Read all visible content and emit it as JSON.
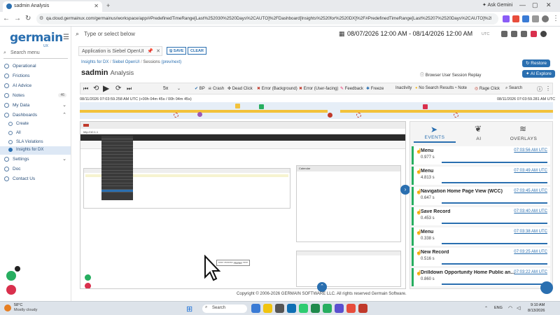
{
  "browser": {
    "tab_title": "sadmin Analysis",
    "ask_gemini": "Ask Gemini",
    "url": "qa.cloud.germainux.com/germainus/workspace/app/#PredefinedTimeRange[Last%252030%2520Days%2CAUTO]%2FDashboard[Insights%2520for%2520DX]%2F#PredefinedTimeRange[Last%25207%2520Days%2CAUTO]%2FFilter[Applicati..."
  },
  "sidebar": {
    "logo": "germain",
    "logo_sub": "UX",
    "search_placeholder": "Search menu",
    "items": [
      {
        "label": "Operational"
      },
      {
        "label": "Frictions"
      },
      {
        "label": "AI Advice"
      },
      {
        "label": "Notes",
        "badge": "46"
      },
      {
        "label": "My Data"
      },
      {
        "label": "Dashboards"
      },
      {
        "label": "Create"
      },
      {
        "label": "All"
      },
      {
        "label": "SLA Violations"
      },
      {
        "label": "Insights for DX"
      },
      {
        "label": "Settings"
      },
      {
        "label": "Doc"
      },
      {
        "label": "Contact Us"
      }
    ]
  },
  "topbar": {
    "search_placeholder": "Type or select below",
    "date_range": "08/07/2026 12:00 AM - 08/14/2026 12:00 AM",
    "timezone": "UTC"
  },
  "filter": {
    "chip": "Application  is  Siebel OpenUI",
    "save": "SAVE",
    "clear": "CLEAR"
  },
  "breadcrumb": {
    "insights": "Insights for DX",
    "app": "Siebel OpenUI",
    "sessions": "Sessions",
    "prevnext": "(prev/next)"
  },
  "page": {
    "title": "sadmin",
    "title_sub": "Analysis",
    "restore": "Restore",
    "ai_explore": "AI Explore",
    "replay_label": "Browser User Session Replay"
  },
  "toolbar": {
    "speed": "5x",
    "filters": [
      "BP",
      "Crash",
      "Dead Click",
      "Error (Background)",
      "Error (User-facing)",
      "Feedback",
      "Freeze",
      "Inactivity",
      "No Search Results",
      "Note",
      "Rage Click",
      "Search"
    ]
  },
  "timeline": {
    "start": "08/11/2026 07:03:59.258 AM UTC (+00h 04m 45s / 00h 04m 45s)",
    "end": "08/11/2026 07:03:59.281 AM UTC"
  },
  "replay": {
    "url": "http://10.1.1",
    "tooltip": "**** ******* Home ****",
    "calendar_title": "Calendar"
  },
  "rpanel": {
    "tabs": [
      "EVENTS",
      "AI",
      "OVERLAYS"
    ],
    "events": [
      {
        "name": "Menu",
        "time": "07:03:56 AM UTC",
        "duration": "0.977 s"
      },
      {
        "name": "Menu",
        "time": "07:03:49 AM UTC",
        "duration": "4.813 s"
      },
      {
        "name": "Navigation Home Page View (WCC)",
        "time": "07:03:45 AM UTC",
        "duration": "0.647 s"
      },
      {
        "name": "Save Record",
        "time": "07:03:40 AM UTC",
        "duration": "0.453 s"
      },
      {
        "name": "Menu",
        "time": "07:03:38 AM UTC",
        "duration": "0.338 s"
      },
      {
        "name": "New Record",
        "time": "07:03:25 AM UTC",
        "duration": "0.516 s"
      },
      {
        "name": "Drilldown Opportunity Home Public an...",
        "time": "07:03:22 AM UTC",
        "duration": "0.860 s"
      }
    ]
  },
  "footer": {
    "copyright": "Copyright © 2006-2026 GERMAIN SOFTWARE LLC. All rights reserved Germain Software."
  },
  "taskbar": {
    "weather_temp": "58°C",
    "weather_desc": "Mostly cloudy",
    "search": "Search",
    "lang": "ENG",
    "time": "9:10 AM",
    "date": "8/13/2026"
  },
  "colors": {
    "brand": "#2a6fb0",
    "event_ok": "#27ae60",
    "timeline_bar": "#f2c23c"
  }
}
